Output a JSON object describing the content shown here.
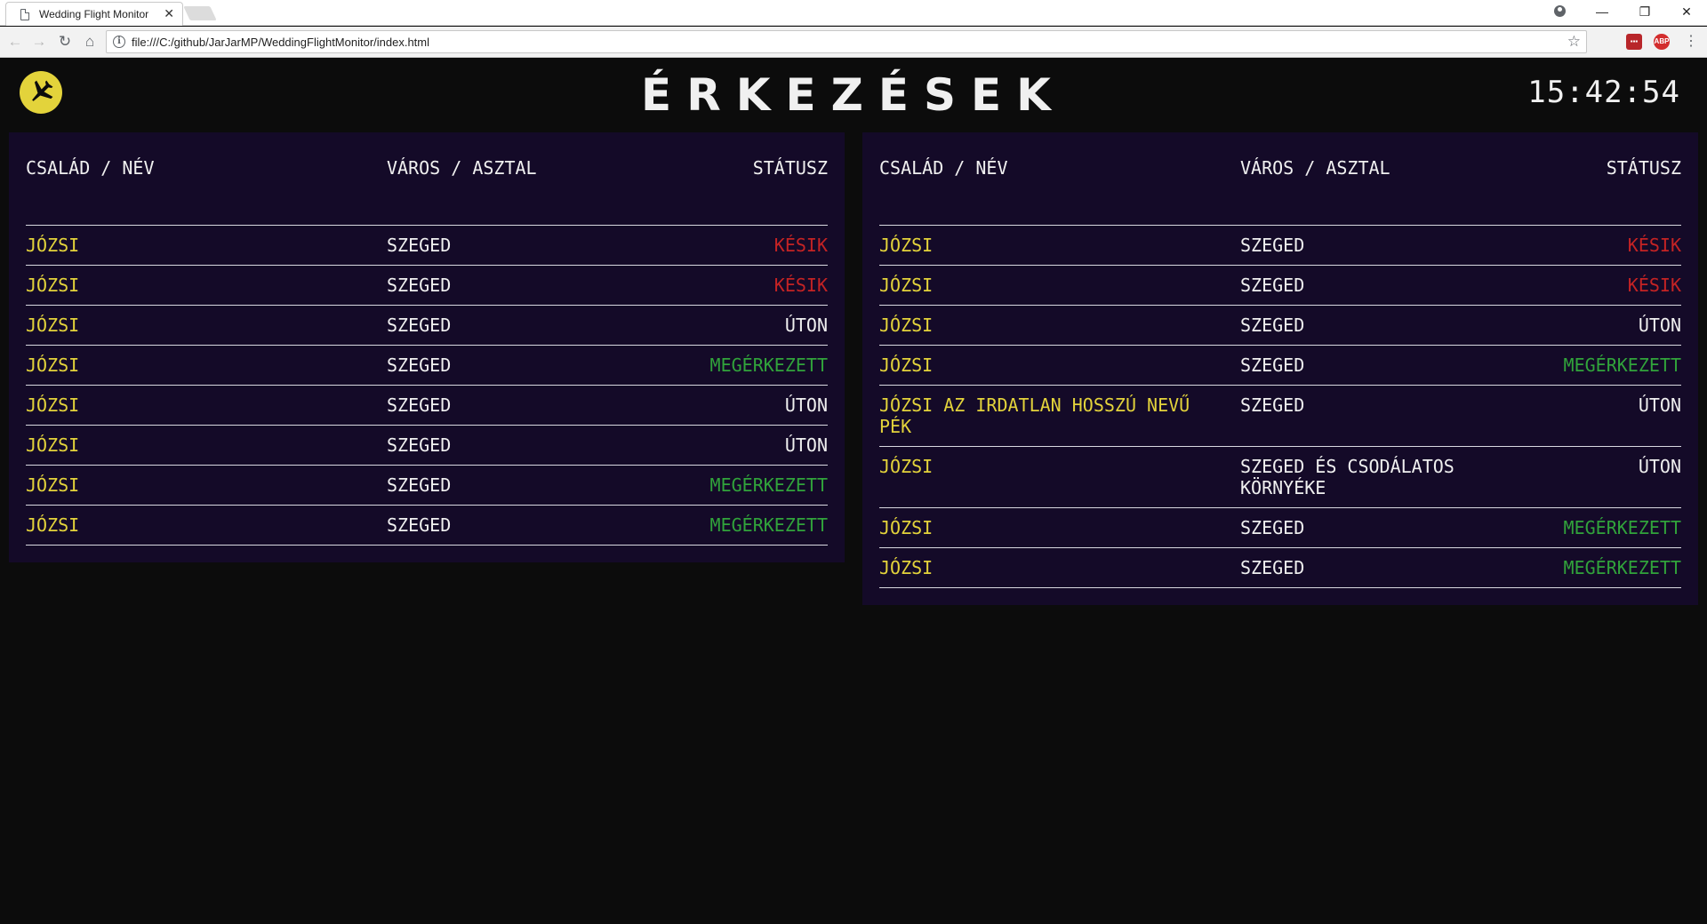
{
  "browser": {
    "tab_title": "Wedding Flight Monitor",
    "tab_close": "✕",
    "url": "file:///C:/github/JarJarMP/WeddingFlightMonitor/index.html",
    "ext1": "▪▪▪",
    "ext2": "ABP",
    "win_min": "—",
    "win_max": "❐",
    "win_close": "✕",
    "back": "←",
    "forward": "→",
    "reload": "↻",
    "home": "⌂",
    "star": "☆",
    "menu": "⋮"
  },
  "app": {
    "title": "ÉRKEZÉSEK",
    "clock": "15:42:54",
    "logo_icon": "plane-icon",
    "colors": {
      "name": "#e3d33b",
      "late": "#c42324",
      "arrived": "#31a33b",
      "board_bg": "#140a28"
    }
  },
  "boards": [
    {
      "headers": {
        "name": "CSALÁD / NÉV",
        "city": "VÁROS / ASZTAL",
        "status": "STÁTUSZ"
      },
      "rows": [
        {
          "name": "JÓZSI",
          "city": "SZEGED",
          "status": "KÉSIK",
          "state": "late"
        },
        {
          "name": "JÓZSI",
          "city": "SZEGED",
          "status": "KÉSIK",
          "state": "late"
        },
        {
          "name": "JÓZSI",
          "city": "SZEGED",
          "status": "ÚTON",
          "state": "way"
        },
        {
          "name": "JÓZSI",
          "city": "SZEGED",
          "status": "MEGÉRKEZETT",
          "state": "arrived"
        },
        {
          "name": "JÓZSI",
          "city": "SZEGED",
          "status": "ÚTON",
          "state": "way"
        },
        {
          "name": "JÓZSI",
          "city": "SZEGED",
          "status": "ÚTON",
          "state": "way"
        },
        {
          "name": "JÓZSI",
          "city": "SZEGED",
          "status": "MEGÉRKEZETT",
          "state": "arrived"
        },
        {
          "name": "JÓZSI",
          "city": "SZEGED",
          "status": "MEGÉRKEZETT",
          "state": "arrived"
        }
      ]
    },
    {
      "headers": {
        "name": "CSALÁD / NÉV",
        "city": "VÁROS / ASZTAL",
        "status": "STÁTUSZ"
      },
      "rows": [
        {
          "name": "JÓZSI",
          "city": "SZEGED",
          "status": "KÉSIK",
          "state": "late"
        },
        {
          "name": "JÓZSI",
          "city": "SZEGED",
          "status": "KÉSIK",
          "state": "late"
        },
        {
          "name": "JÓZSI",
          "city": "SZEGED",
          "status": "ÚTON",
          "state": "way"
        },
        {
          "name": "JÓZSI",
          "city": "SZEGED",
          "status": "MEGÉRKEZETT",
          "state": "arrived"
        },
        {
          "name": "JÓZSI AZ IRDATLAN HOSSZÚ NEVŰ PÉK",
          "city": "SZEGED",
          "status": "ÚTON",
          "state": "way"
        },
        {
          "name": "JÓZSI",
          "city": "SZEGED ÉS CSODÁLATOS KÖRNYÉKE",
          "status": "ÚTON",
          "state": "way"
        },
        {
          "name": "JÓZSI",
          "city": "SZEGED",
          "status": "MEGÉRKEZETT",
          "state": "arrived"
        },
        {
          "name": "JÓZSI",
          "city": "SZEGED",
          "status": "MEGÉRKEZETT",
          "state": "arrived"
        }
      ]
    }
  ]
}
